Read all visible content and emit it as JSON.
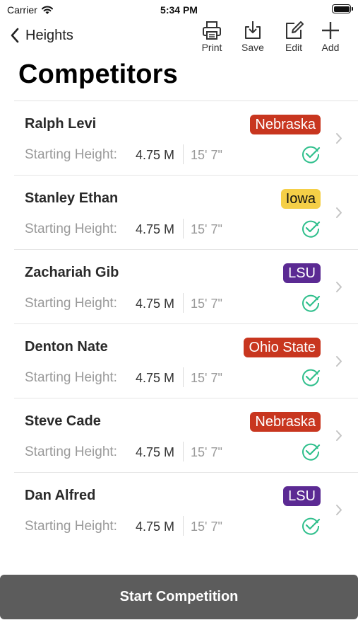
{
  "status_bar": {
    "carrier": "Carrier",
    "time": "5:34 PM"
  },
  "nav": {
    "back_label": "Heights",
    "tools": [
      {
        "label": "Print",
        "icon": "printer-icon"
      },
      {
        "label": "Save",
        "icon": "download-icon"
      },
      {
        "label": "Edit",
        "icon": "edit-icon"
      },
      {
        "label": "Add",
        "icon": "plus-icon"
      }
    ]
  },
  "page_title": "Competitors",
  "starting_height_label": "Starting Height:",
  "competitors": [
    {
      "name": "Ralph Levi",
      "team": "Nebraska",
      "team_color": "#c8361f",
      "height_metric": "4.75 M",
      "height_imperial": "15' 7\""
    },
    {
      "name": "Stanley Ethan",
      "team": "Iowa",
      "team_color": "#f5cf47",
      "team_text_color": "#111111",
      "height_metric": "4.75 M",
      "height_imperial": "15' 7\""
    },
    {
      "name": "Zachariah Gib",
      "team": "LSU",
      "team_color": "#5b2a93",
      "height_metric": "4.75 M",
      "height_imperial": "15' 7\""
    },
    {
      "name": "Denton Nate",
      "team": "Ohio State",
      "team_color": "#c8361f",
      "height_metric": "4.75 M",
      "height_imperial": "15' 7\""
    },
    {
      "name": "Steve Cade",
      "team": "Nebraska",
      "team_color": "#c8361f",
      "height_metric": "4.75 M",
      "height_imperial": "15' 7\""
    },
    {
      "name": "Dan Alfred",
      "team": "LSU",
      "team_color": "#5b2a93",
      "height_metric": "4.75 M",
      "height_imperial": "15' 7\""
    }
  ],
  "check_color": "#2fbf8c",
  "start_button_label": "Start Competition"
}
